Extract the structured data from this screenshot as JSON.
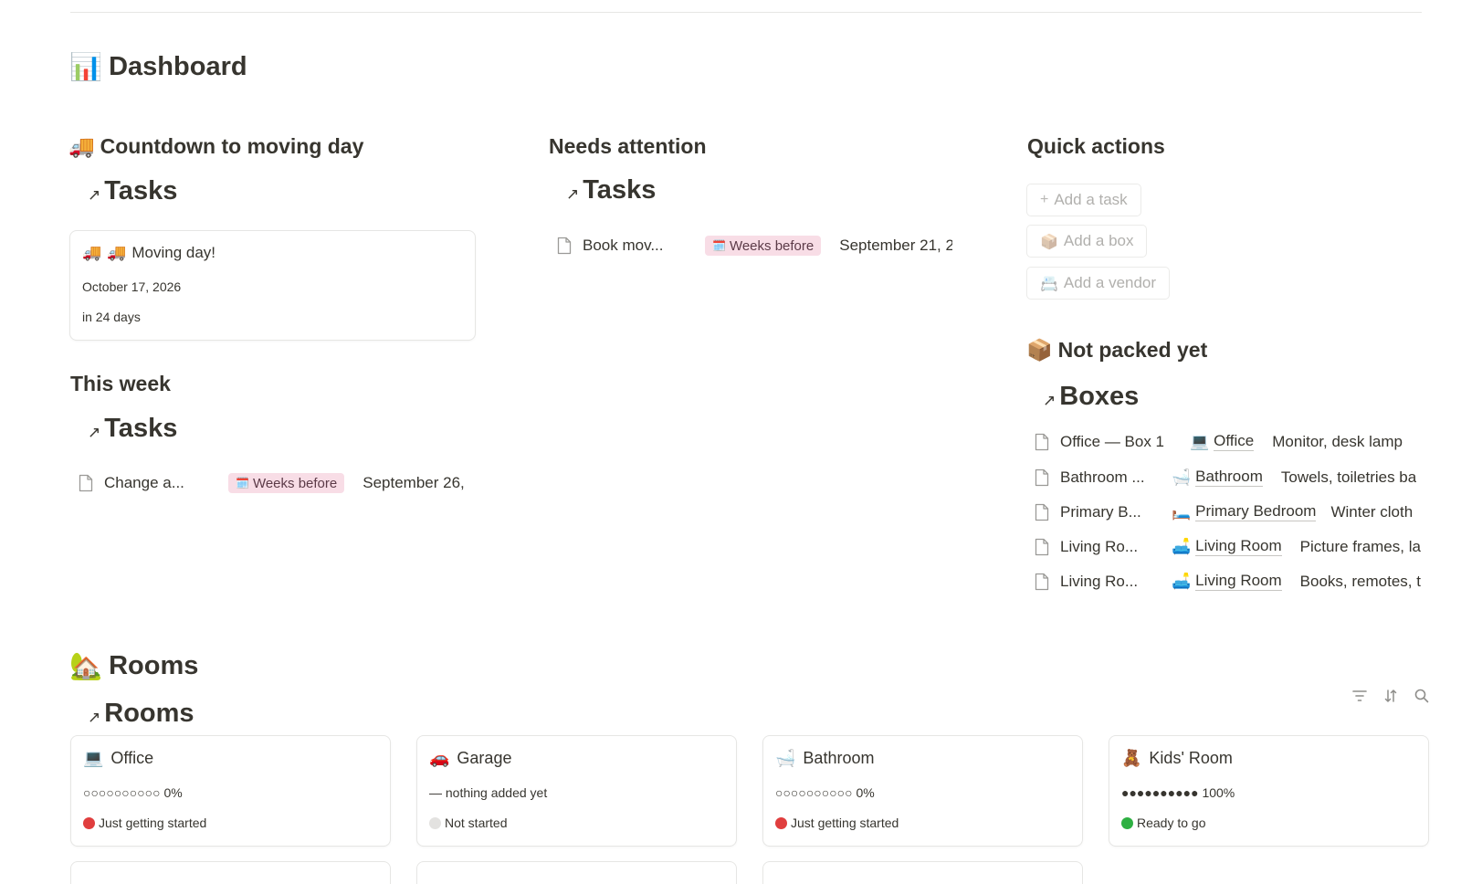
{
  "page": {
    "title_icon": "📊",
    "title": "Dashboard"
  },
  "countdown": {
    "icon": "🚚",
    "heading": "Countdown to moving day",
    "linked_db": "Tasks",
    "card": {
      "icon1": "🚚",
      "icon2": "🚚",
      "title": "Moving day!",
      "date": "October 17, 2026",
      "relative": "in 24 days"
    }
  },
  "this_week": {
    "heading": "This week",
    "linked_db": "Tasks",
    "rows": [
      {
        "name": "Change a...",
        "tag_icon": "🗓️",
        "tag": "Weeks before",
        "date": "September 26,"
      }
    ]
  },
  "needs_attention": {
    "heading": "Needs attention",
    "linked_db": "Tasks",
    "rows": [
      {
        "name": "Book mov...",
        "tag_icon": "🗓️",
        "tag": "Weeks before",
        "date": "September 21, 2"
      }
    ]
  },
  "quick_actions": {
    "heading": "Quick actions",
    "buttons": [
      {
        "icon": "+",
        "label": "Add a task"
      },
      {
        "icon": "📦",
        "label": "Add a box"
      },
      {
        "icon": "📇",
        "label": "Add a vendor"
      }
    ]
  },
  "not_packed": {
    "icon": "📦",
    "heading": "Not packed yet",
    "linked_db": "Boxes",
    "rows": [
      {
        "name": "Office — Box 1",
        "room_icon": "💻",
        "room": "Office",
        "contents": "Monitor, desk lamp"
      },
      {
        "name": "Bathroom ...",
        "room_icon": "🛁",
        "room": "Bathroom",
        "contents": "Towels, toiletries ba"
      },
      {
        "name": "Primary B...",
        "room_icon": "🛏️",
        "room": "Primary Bedroom",
        "contents": "Winter cloth"
      },
      {
        "name": "Living Ro...",
        "room_icon": "🛋️",
        "room": "Living Room",
        "contents": "Picture frames, la"
      },
      {
        "name": "Living Ro...",
        "room_icon": "🛋️",
        "room": "Living Room",
        "contents": "Books, remotes, t"
      }
    ]
  },
  "rooms": {
    "icon": "🏡",
    "heading": "Rooms",
    "linked_db": "Rooms",
    "tools": [
      "filter-icon",
      "sort-icon",
      "search-icon"
    ],
    "cards": [
      {
        "icon": "💻",
        "name": "Office",
        "progress": "○○○○○○○○○○ 0%",
        "status_color": "#e03e3e",
        "status": "Just getting started"
      },
      {
        "icon": "🚗",
        "name": "Garage",
        "progress": "— nothing added yet",
        "status_color": "#e3e2e0",
        "status": "Not started"
      },
      {
        "icon": "🛁",
        "name": "Bathroom",
        "progress": "○○○○○○○○○○ 0%",
        "status_color": "#e03e3e",
        "status": "Just getting started"
      },
      {
        "icon": "🧸",
        "name": "Kids' Room",
        "progress": "●●●●●●●●●● 100%",
        "status_color": "#2eb042",
        "status": "Ready to go"
      }
    ]
  },
  "colors": {
    "tag_bg": "#f8dde6",
    "text": "#37352f",
    "border": "#e6e6e4"
  }
}
